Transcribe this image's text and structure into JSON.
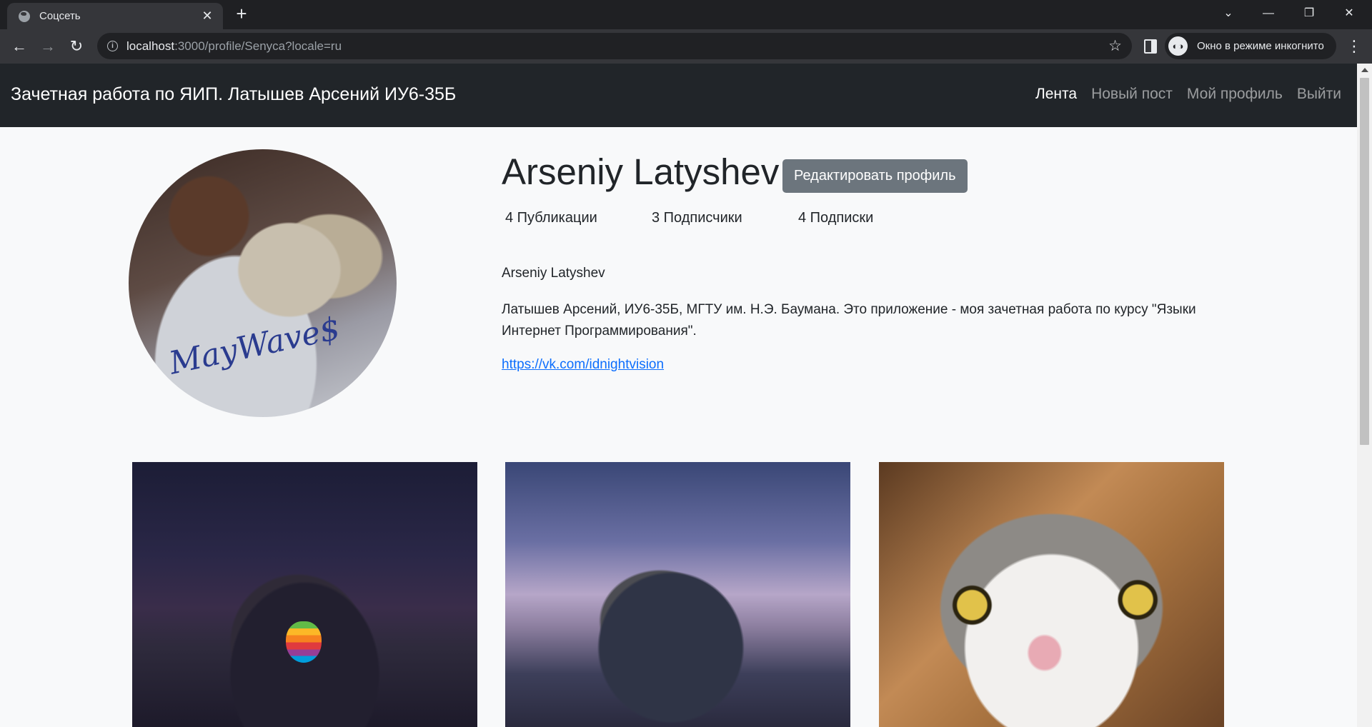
{
  "browser": {
    "tab_title": "Соцсеть",
    "url_host": "localhost",
    "url_rest": ":3000/profile/Senyca?locale=ru",
    "incognito_label": "Окно в режиме инкогнито"
  },
  "navbar": {
    "brand": "Зачетная работа по ЯИП. Латышев Арсений ИУ6-35Б",
    "links": [
      "Лента",
      "Новый пост",
      "Мой профиль",
      "Выйти"
    ]
  },
  "profile": {
    "name": "Arseniy Latyshev",
    "edit_button": "Редактировать профиль",
    "stats": {
      "posts": "4 Публикации",
      "followers": "3 Подписчики",
      "following": "4 Подписки"
    },
    "display_name": "Arseniy Latyshev",
    "bio": "Латышев Арсений, ИУ6-35Б, МГТУ им. Н.Э. Баумана. Это приложение - моя зачетная работа по курсу \"Языки Интернет Программирования\".",
    "link": "https://vk.com/idnightvision"
  }
}
